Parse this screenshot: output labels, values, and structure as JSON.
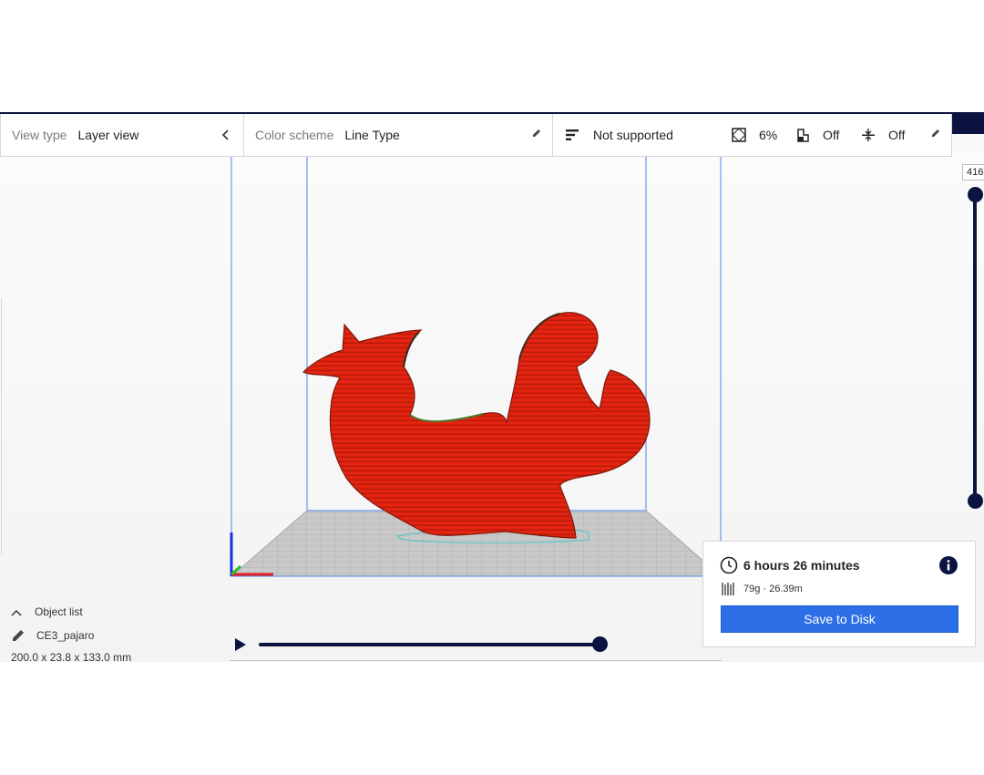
{
  "toolbar": {
    "view_type_label": "View type",
    "view_type_value": "Layer view",
    "color_scheme_label": "Color scheme",
    "color_scheme_value": "Line Type",
    "print_settings": {
      "support": "Not supported",
      "infill": "6%",
      "adhesion": "Off",
      "ironing": "Off"
    }
  },
  "layer_slider": {
    "max_layer": "416"
  },
  "object_panel": {
    "header": "Object list",
    "object_name": "CE3_pajaro",
    "dimensions": "200.0 x 23.8 x 133.0 mm"
  },
  "print_summary": {
    "time": "6 hours 26 minutes",
    "material": "79g · 26.39m",
    "save_button": "Save to Disk"
  },
  "colors": {
    "model": "#e0240f",
    "accent_dark": "#0b1440",
    "primary_button": "#2c6fe6",
    "build_volume_lines": "#4a86e8",
    "plate": "#c8c8c8"
  },
  "icons": [
    "chevron-left-icon",
    "pencil-icon",
    "support-icon",
    "infill-icon",
    "adhesion-icon",
    "ironing-icon",
    "play-icon",
    "clock-icon",
    "info-icon",
    "filament-icon",
    "view-3d-icon",
    "view-front-icon",
    "view-top-icon",
    "view-left-icon",
    "view-right-icon"
  ]
}
